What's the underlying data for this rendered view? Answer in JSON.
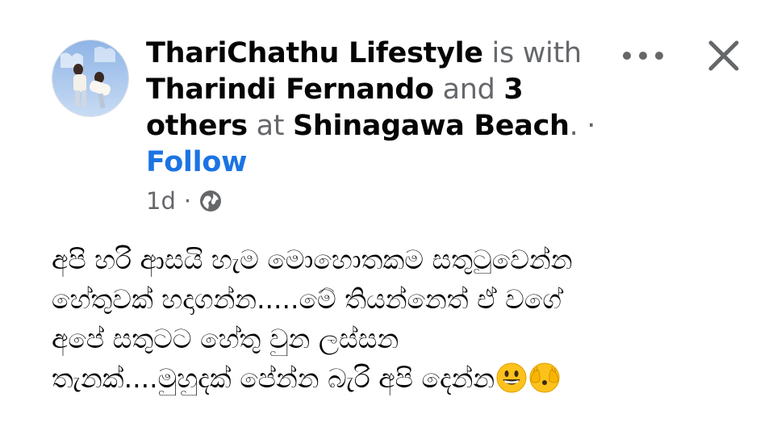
{
  "post": {
    "author": "ThariChathu Lifestyle",
    "is_with": "is with",
    "tagged_person": "Tharindi Fernando",
    "and_word": "and",
    "others_count": "3",
    "others_word": "others",
    "at_word": "at",
    "location": "Shinagawa Beach",
    "location_period": ".",
    "separator": "·",
    "follow_label": "Follow",
    "time": "1d",
    "meta_separator": "·",
    "privacy_icon": "globe-icon",
    "body_lines": [
      "අපි හරි ආසයි හැම මොහොතකම සතුටුවෙන්න",
      "හේතුවක් හදාගන්න.....මේ තියන්නෙත් ඒ වගේ",
      "අපේ සතුටට හේතු වුන ලස්සන",
      "තැනක්....මුහුදක් පේන්න බැරි අපි දෙන්න"
    ],
    "emojis": [
      "grinning-face-emoji",
      "face-with-peeking-eye-emoji"
    ]
  },
  "controls": {
    "more_icon": "more-horizontal-icon",
    "close_icon": "close-icon"
  },
  "colors": {
    "text": "#050505",
    "muted": "#65676b",
    "link": "#1b74e4"
  }
}
